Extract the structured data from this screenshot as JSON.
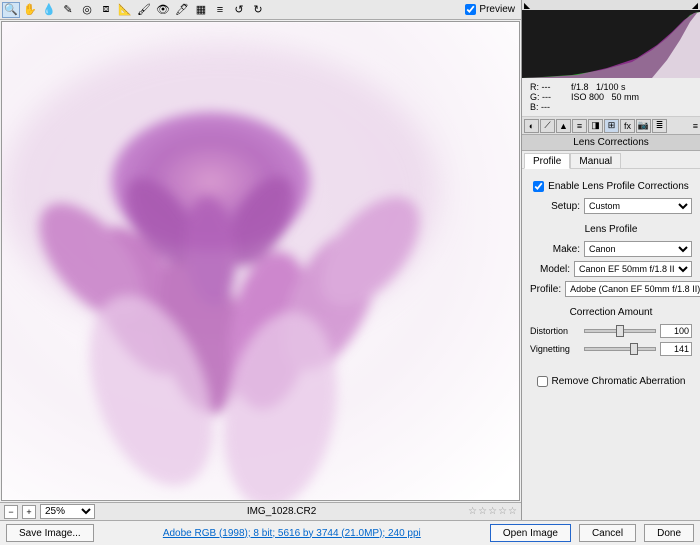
{
  "toolbar": {
    "preview_label": "Preview",
    "preview_checked": true
  },
  "zoom": {
    "value": "25%"
  },
  "filename": "IMG_1028.CR2",
  "info": {
    "r": "R: ---",
    "g": "G: ---",
    "b": "B: ---",
    "aperture": "f/1.8",
    "shutter": "1/100 s",
    "iso": "ISO 800",
    "focal": "50 mm"
  },
  "panel": {
    "title": "Lens Corrections",
    "tabs": {
      "profile": "Profile",
      "manual": "Manual"
    },
    "enable_label": "Enable Lens Profile Corrections",
    "enable_checked": true,
    "setup_label": "Setup:",
    "setup_value": "Custom",
    "lens_profile_title": "Lens Profile",
    "make_label": "Make:",
    "make_value": "Canon",
    "model_label": "Model:",
    "model_value": "Canon EF 50mm f/1.8 II",
    "profile_label": "Profile:",
    "profile_value": "Adobe (Canon EF 50mm f/1.8 II)",
    "correction_title": "Correction Amount",
    "distortion_label": "Distortion",
    "distortion_value": "100",
    "vignetting_label": "Vignetting",
    "vignetting_value": "141",
    "chromatic_label": "Remove Chromatic Aberration",
    "chromatic_checked": false
  },
  "bottom": {
    "save_image": "Save Image...",
    "color_info": "Adobe RGB (1998); 8 bit; 5616 by 3744 (21.0MP); 240 ppi",
    "open_image": "Open Image",
    "cancel": "Cancel",
    "done": "Done"
  }
}
